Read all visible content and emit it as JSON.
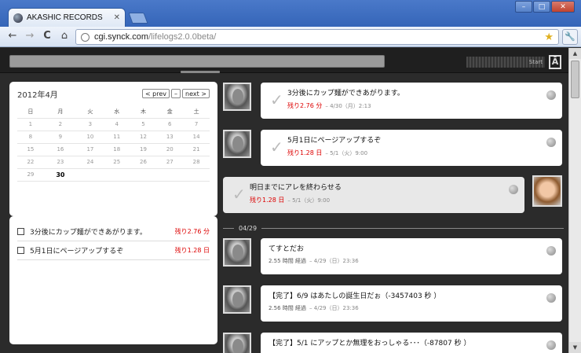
{
  "browser": {
    "tab_title": "AKASHIC RECORDS",
    "tab_close": "✕",
    "url_host": "cgi.synck.com",
    "url_path": "/lifelogs2.0.0beta/",
    "win_min": "–",
    "win_max": "□",
    "win_close": "✕",
    "back": "←",
    "forward": "→",
    "reload": "C",
    "home": "⌂",
    "star": "★",
    "wrench": "🔧"
  },
  "header": {
    "start_label": "Start",
    "logo": "Ā"
  },
  "calendar": {
    "title": "2012年4月",
    "prev": "< prev",
    "today": "–",
    "next": "next >",
    "weekdays": [
      "日",
      "月",
      "火",
      "水",
      "木",
      "金",
      "土"
    ],
    "weeks": [
      [
        "1",
        "2",
        "3",
        "4",
        "5",
        "6",
        "7"
      ],
      [
        "8",
        "9",
        "10",
        "11",
        "12",
        "13",
        "14"
      ],
      [
        "15",
        "16",
        "17",
        "18",
        "19",
        "20",
        "21"
      ],
      [
        "22",
        "23",
        "24",
        "25",
        "26",
        "27",
        "28"
      ],
      [
        "29",
        "30",
        "",
        "",
        "",
        "",
        ""
      ]
    ]
  },
  "todos": [
    {
      "text": "3分後にカップ麺ができあがります。",
      "left": "残り2.76 分"
    },
    {
      "text": "5月1日にページアップするぞ",
      "left": "残り1.28 日"
    }
  ],
  "feed": {
    "entries": [
      {
        "text": "3分後にカップ麺ができあがります。",
        "left": "残り2.76 分",
        "date": "– 4/30（月）2:13"
      },
      {
        "text": "5月1日にページアップするぞ",
        "left": "残り1.28 日",
        "date": "– 5/1（火）9:00"
      },
      {
        "text": "明日までにアレを終わらせる",
        "left": "残り1.28 日",
        "date": "– 5/1（火）9:00"
      }
    ],
    "divider_label": "04/29",
    "past": [
      {
        "text": "てすとだお",
        "status": "2.55 時間 経過",
        "date": "– 4/29（日）23:36"
      },
      {
        "text": "【完了】6/9 はあたしの誕生日だぉ（-3457403 秒 ）",
        "status": "2.56 時間 経過",
        "date": "– 4/29（日）23:36"
      },
      {
        "text": "【完了】5/1 にアップとか無理をおっしゃる･･･（-87807 秒 ）",
        "status": "",
        "date": ""
      }
    ]
  },
  "scroll": {
    "up": "▲",
    "down": "▼"
  }
}
